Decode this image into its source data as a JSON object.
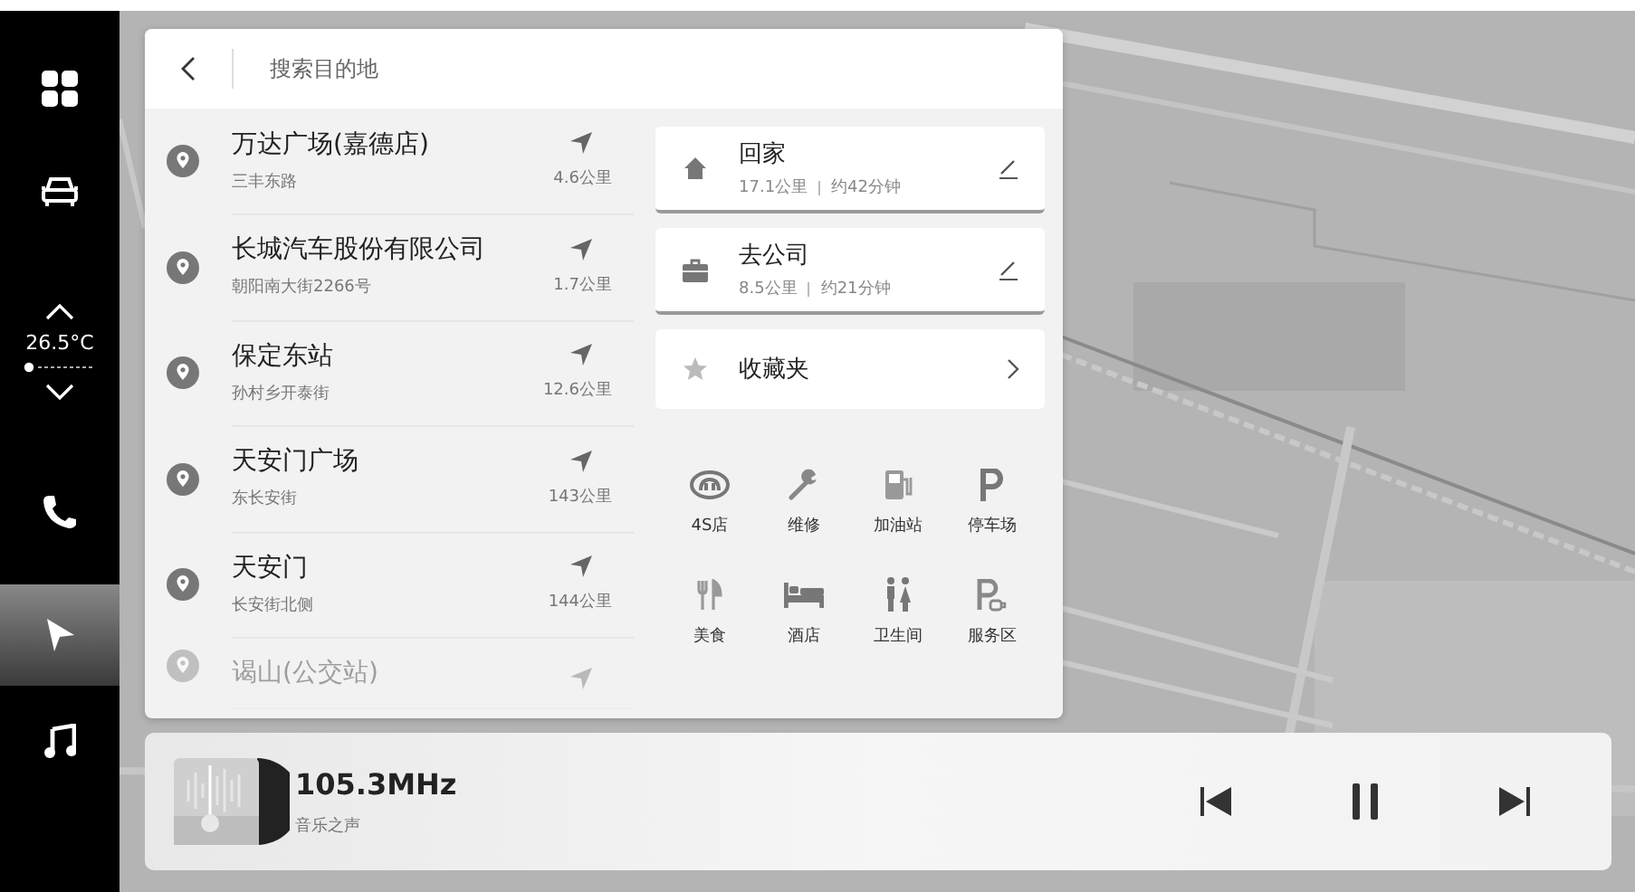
{
  "sidebar": {
    "items": [
      {
        "kind": "apps",
        "selected": false
      },
      {
        "kind": "car",
        "selected": false
      },
      {
        "kind": "climate",
        "temperature": "26.5°C"
      },
      {
        "kind": "phone",
        "selected": false
      },
      {
        "kind": "navigation",
        "selected": true
      },
      {
        "kind": "music",
        "selected": false
      }
    ]
  },
  "search": {
    "placeholder": "搜索目的地"
  },
  "results": [
    {
      "name": "万达广场(嘉德店)",
      "address": "三丰东路",
      "distance": "4.6公里"
    },
    {
      "name": "长城汽车股份有限公司",
      "address": "朝阳南大街2266号",
      "distance": "1.7公里"
    },
    {
      "name": "保定东站",
      "address": "孙村乡开泰街",
      "distance": "12.6公里"
    },
    {
      "name": "天安门广场",
      "address": "东长安街",
      "distance": "143公里"
    },
    {
      "name": "天安门",
      "address": "长安街北侧",
      "distance": "144公里"
    },
    {
      "name": "谒山(公交站)"
    }
  ],
  "shortcuts": [
    {
      "kind": "home",
      "title": "回家",
      "distance": "17.1公里",
      "eta": "约42分钟"
    },
    {
      "kind": "work",
      "title": "去公司",
      "distance": "8.5公里",
      "eta": "约21分钟"
    },
    {
      "kind": "favorites",
      "title": "收藏夹"
    }
  ],
  "categories": [
    {
      "kind": "dealer",
      "label": "4S店"
    },
    {
      "kind": "repair",
      "label": "维修"
    },
    {
      "kind": "fuel",
      "label": "加油站"
    },
    {
      "kind": "parking",
      "label": "停车场"
    },
    {
      "kind": "food",
      "label": "美食"
    },
    {
      "kind": "hotel",
      "label": "酒店"
    },
    {
      "kind": "restroom",
      "label": "卫生间"
    },
    {
      "kind": "service",
      "label": "服务区"
    }
  ],
  "player": {
    "station": "105.3MHz",
    "program": "音乐之声",
    "playing": true
  }
}
